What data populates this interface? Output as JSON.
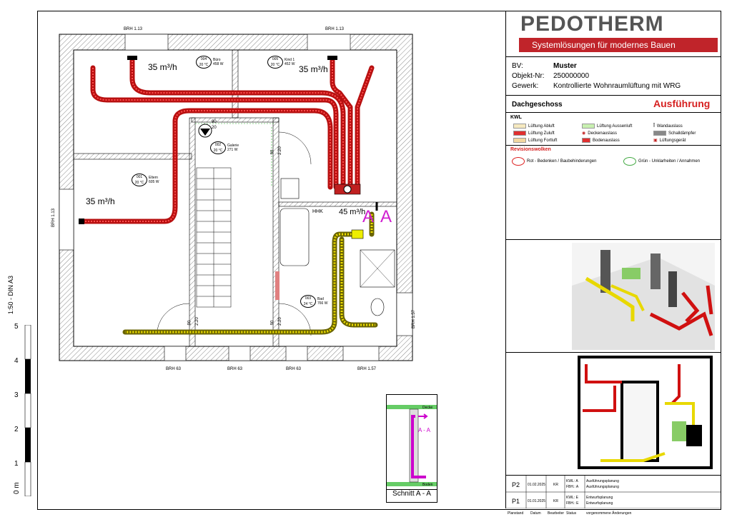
{
  "company": {
    "name": "PEDOTHERM",
    "slogan": "Systemlösungen für modernes Bauen"
  },
  "project": {
    "bv_label": "BV:",
    "bv_value": "Muster",
    "objekt_label": "Objekt-Nr:",
    "objekt_value": "250000000",
    "gewerk_label": "Gewerk:",
    "gewerk_value": "Kontrollierte Wohnraumlüftung mit WRG"
  },
  "floor": "Dachgeschoss",
  "status": "Ausführung",
  "legend": {
    "title": "KWL",
    "items": [
      "Lüftung Abluft",
      "Lüftung Aussenluft",
      "Wandauslass",
      "Lüftung Zuluft",
      "Deckenauslass",
      "Schalldämpfer",
      "Lüftung Fortluft",
      "Bodenauslass",
      "Lüftungsgerät"
    ]
  },
  "revision": {
    "title": "Revisionswolken",
    "red": "Rot - Bedenken / Baubehinderungen",
    "green": "Grün - Unklarheiten / Annahmen"
  },
  "revtable": {
    "rows": [
      {
        "code": "P2",
        "date": "01.02.2025",
        "by": "KR",
        "a": "KWL: A",
        "b": "Ausführungsplanung",
        "c": "FBH.: A",
        "d": "Ausführungsplanung"
      },
      {
        "code": "P1",
        "date": "01.01.2025",
        "by": "KR",
        "a": "KWL: E",
        "b": "Entwurfsplanung",
        "c": "FBH.: E",
        "d": "Entwurfsplanung"
      }
    ],
    "footer": [
      "Planstand",
      "Datum",
      "Bearbeiter",
      "Status",
      "vorgenommene Änderungen"
    ]
  },
  "scale_text": "1:50 - DIN A3",
  "scale_ticks": [
    "5",
    "4",
    "3",
    "2",
    "1",
    "0 m"
  ],
  "plan": {
    "brh": [
      "BRH 1.13",
      "BRH 1.13",
      "BRH 1.13",
      "BRH 1.57",
      "BRH 63",
      "BRH 63",
      "BRH 63",
      "BRH 1.57"
    ],
    "rooms": [
      {
        "num": "004",
        "name": "Büro",
        "temp": "20 °C",
        "watt": "458 W"
      },
      {
        "num": "005",
        "name": "Kind 1",
        "temp": "20 °C",
        "watt": "452 W"
      },
      {
        "num": "002",
        "name": "Galerie",
        "temp": "20 °C",
        "watt": "271 W"
      },
      {
        "num": "001",
        "name": "Eltern",
        "temp": "20 °C",
        "watt": "605 W"
      },
      {
        "num": "003",
        "name": "Bad",
        "temp": "24 °C",
        "watt": "766 W"
      }
    ],
    "flows": [
      "35 m³/h",
      "35 m³/h",
      "35 m³/h",
      "45 m³/h"
    ],
    "section_marks": [
      "A",
      "A"
    ],
    "hhk": "HHK",
    "door": [
      "90",
      "2.20",
      "90",
      "2.20",
      "90",
      "2.20",
      "90",
      "20"
    ]
  },
  "section": {
    "title": "Schnitt A - A",
    "label": "A - A",
    "top": "Decke",
    "bottom": "Boden"
  }
}
